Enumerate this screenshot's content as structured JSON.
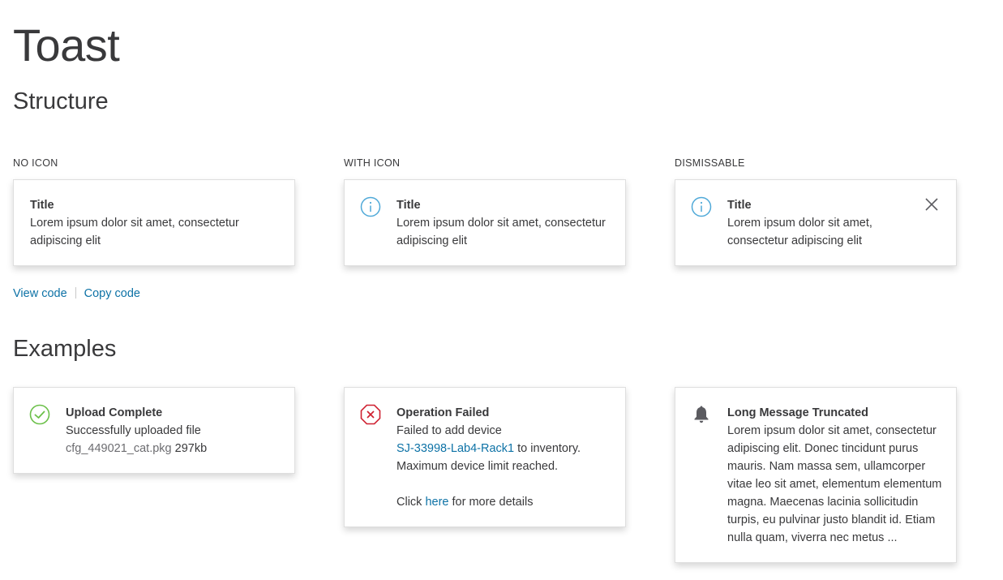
{
  "page_title": "Toast",
  "structure": {
    "heading": "Structure",
    "columns": [
      {
        "label": "NO ICON",
        "title": "Title",
        "message": "Lorem ipsum dolor sit amet, consectetur adipiscing elit"
      },
      {
        "label": "WITH ICON",
        "icon": "info-icon",
        "title": "Title",
        "message": "Lorem ipsum dolor sit amet, consectetur adipiscing elit"
      },
      {
        "label": "DISMISSABLE",
        "icon": "info-icon",
        "title": "Title",
        "message": "Lorem ipsum dolor sit amet, consectetur adipiscing elit",
        "close_icon": "close-icon"
      }
    ],
    "view_code": "View code",
    "copy_code": "Copy code"
  },
  "examples": {
    "heading": "Examples",
    "success": {
      "icon": "check-circle-icon",
      "title": "Upload Complete",
      "line1": "Successfully uploaded file",
      "filename": "cfg_449021_cat.pkg",
      "size": "297kb"
    },
    "error": {
      "icon": "error-octagon-icon",
      "title": "Operation Failed",
      "line1": "Failed to add device",
      "device_link": "SJ-33998-Lab4-Rack1",
      "line2_rest": " to inventory.",
      "line3": "Maximum device limit reached.",
      "click_prefix": "Click ",
      "here_link": "here",
      "click_suffix": " for more details"
    },
    "long": {
      "icon": "bell-icon",
      "title": "Long Message Truncated",
      "message": "Lorem ipsum dolor sit amet, consectetur adipiscing elit. Donec tincidunt purus mauris. Nam massa sem, ullamcorper vitae leo sit amet, elementum elementum magna. Maecenas lacinia sollicitudin turpis, eu pulvinar justo blandit id. Etiam nulla quam, viverra nec metus ..."
    }
  },
  "colors": {
    "info": "#4fa9d8",
    "success": "#6cc04a",
    "error": "#cf2030",
    "link": "#0d72a6",
    "bell": "#5b5b60"
  }
}
